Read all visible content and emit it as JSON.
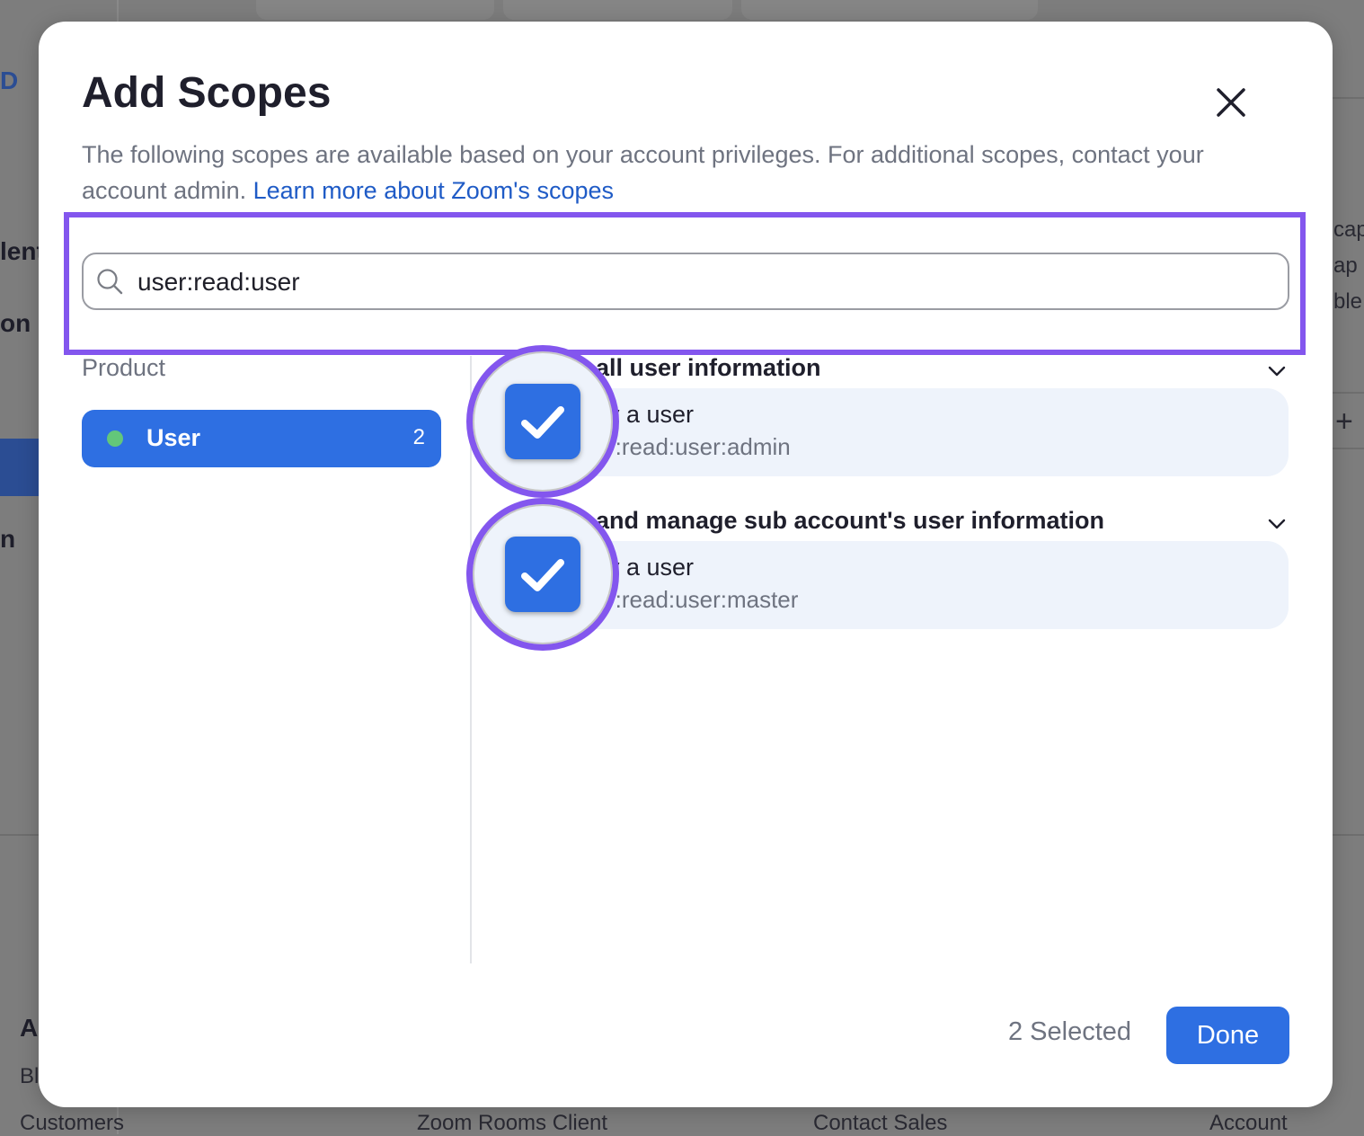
{
  "background": {
    "fragments": [
      "D",
      "lent",
      "on",
      "n",
      "A",
      "Bl",
      "cap",
      "ap",
      "ble",
      "+"
    ],
    "footer_links": [
      "Customers",
      "Zoom Rooms Client",
      "Contact Sales",
      "Account"
    ]
  },
  "modal": {
    "title": "Add Scopes",
    "description": "The following scopes are available based on your account privileges. For additional scopes, contact your account admin.",
    "learn_more_link": "Learn more about Zoom's scopes",
    "search": {
      "value": "user:read:user",
      "placeholder": ""
    },
    "product_label": "Product",
    "products": [
      {
        "name": "User",
        "count": "2",
        "selected": true
      }
    ],
    "groups": [
      {
        "title": "all user information",
        "scope_name": "v a user",
        "scope_id": "r:read:user:admin",
        "checked": true
      },
      {
        "title": "and manage sub account's user information",
        "scope_name": "v a user",
        "scope_id": "r:read:user:master",
        "checked": true
      }
    ],
    "selected_count": "2 Selected",
    "done_label": "Done"
  },
  "colors": {
    "accent": "#2e6fe2",
    "highlight": "#8356ee",
    "status_dot": "#63c77a",
    "link": "#1f5bc6"
  }
}
